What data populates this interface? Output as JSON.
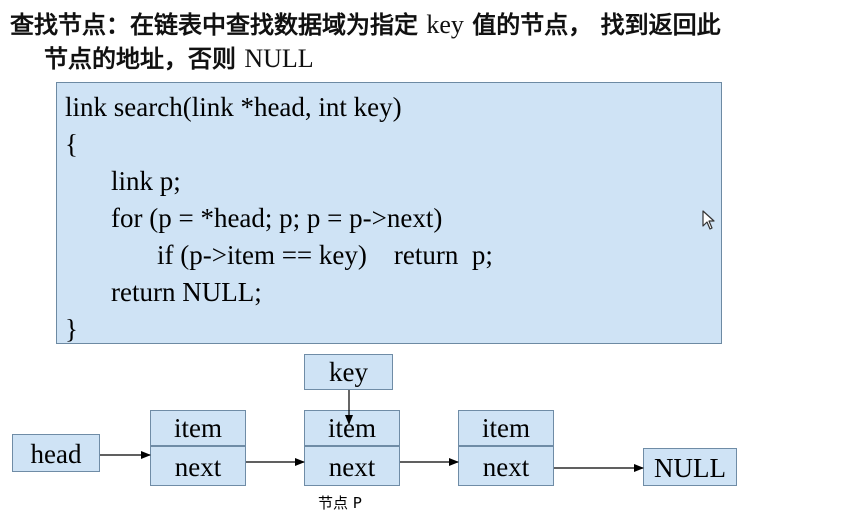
{
  "heading": {
    "line1_a": "查找节点：在链表中查找数据域为指定",
    "line1_key": "key",
    "line1_b": "值的节点， 找到返回此",
    "line2_a": "节点的地址，否则",
    "line2_null": "NULL"
  },
  "code": {
    "lines": [
      "link search(link *head, int key)",
      "{",
      "link p;",
      "for (p = *head; p; p = p->next)",
      "if (p->item == key)    return  p;",
      "return NULL;",
      "}"
    ]
  },
  "diagram": {
    "key_label": "key",
    "head_label": "head",
    "null_label": "NULL",
    "nodes": [
      {
        "item": "item",
        "next": "next"
      },
      {
        "item": "item",
        "next": "next"
      },
      {
        "item": "item",
        "next": "next"
      }
    ],
    "caption": "节点 P"
  },
  "colors": {
    "box_fill": "#cfe3f5",
    "box_border": "#6f8ca6"
  }
}
